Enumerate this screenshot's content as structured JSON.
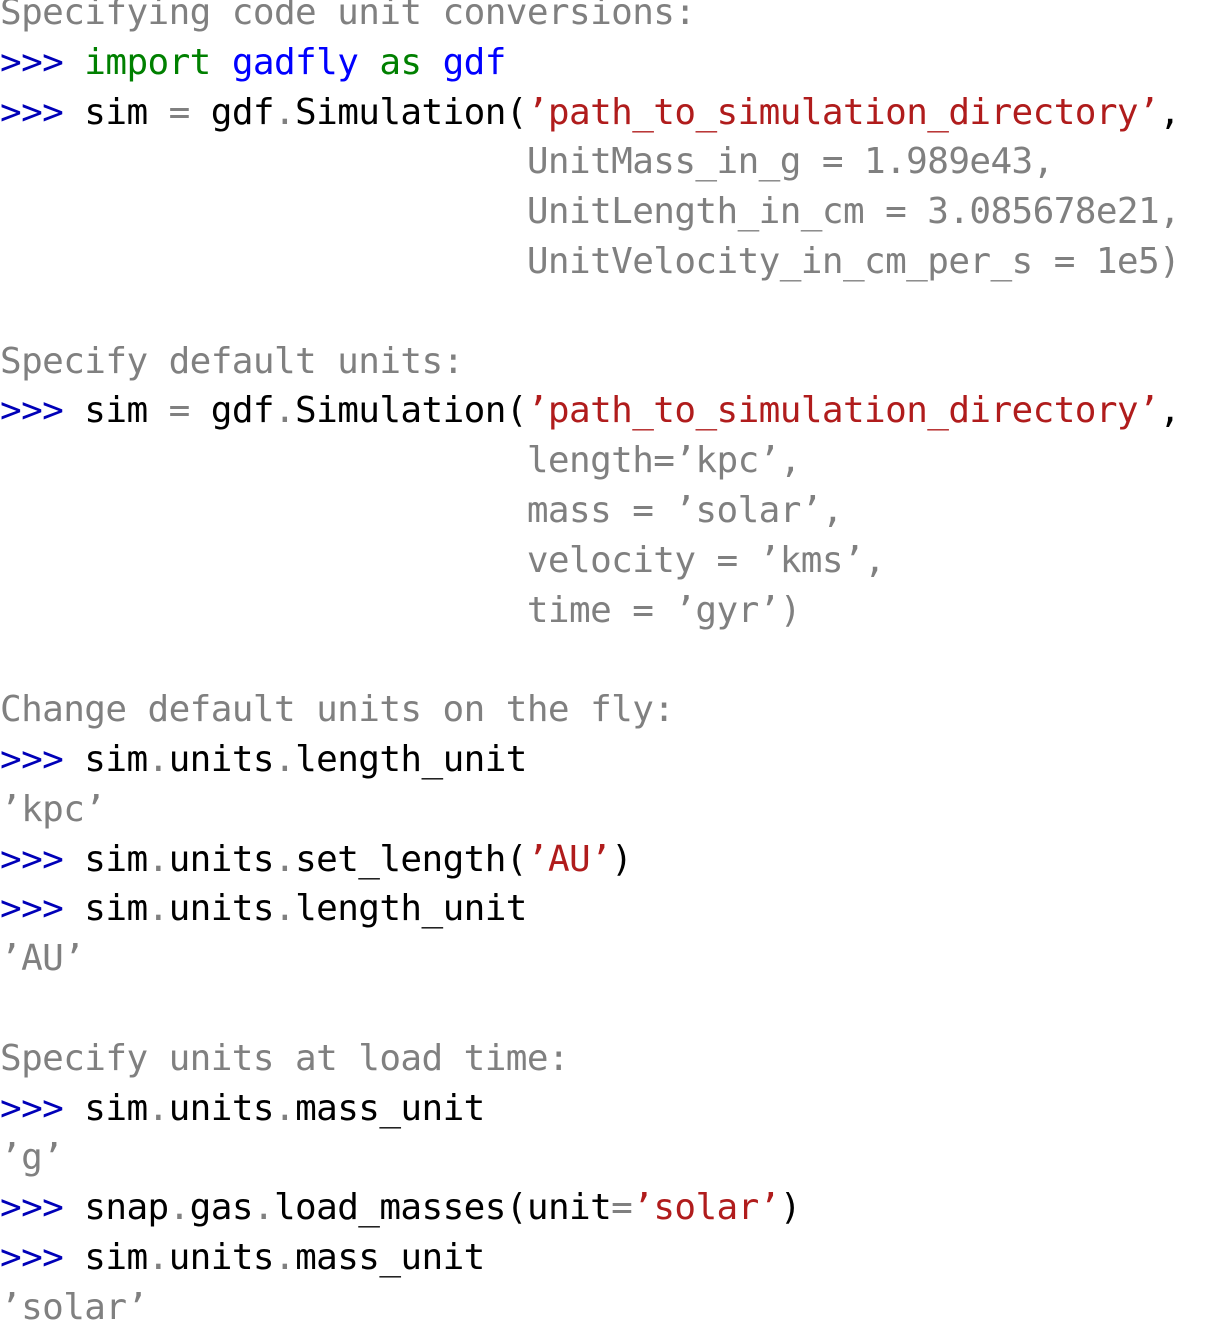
{
  "colors": {
    "prompt": "#0000b8",
    "keyword": "#008000",
    "module": "#0000ff",
    "string": "#b01c1c",
    "comment": "#808080",
    "code": "#000000",
    "operator": "#808080"
  },
  "lines": [
    [
      {
        "t": "Specifying code unit conversions:",
        "c": "comment"
      }
    ],
    [
      {
        "t": ">>> ",
        "c": "prompt"
      },
      {
        "t": "import",
        "c": "keyword"
      },
      {
        "t": " ",
        "c": "code"
      },
      {
        "t": "gadfly",
        "c": "module"
      },
      {
        "t": " ",
        "c": "code"
      },
      {
        "t": "as",
        "c": "keyword"
      },
      {
        "t": " ",
        "c": "code"
      },
      {
        "t": "gdf",
        "c": "module"
      }
    ],
    [
      {
        "t": ">>> ",
        "c": "prompt"
      },
      {
        "t": "sim ",
        "c": "code"
      },
      {
        "t": "=",
        "c": "operator"
      },
      {
        "t": " gdf",
        "c": "code"
      },
      {
        "t": ".",
        "c": "operator"
      },
      {
        "t": "Simulation(",
        "c": "code"
      },
      {
        "t": "’path_to_simulation_directory’",
        "c": "string"
      },
      {
        "t": ",",
        "c": "code"
      }
    ],
    [
      {
        "t": "                         UnitMass_in_g = 1.989e43,",
        "c": "comment"
      }
    ],
    [
      {
        "t": "                         UnitLength_in_cm = 3.085678e21,",
        "c": "comment"
      }
    ],
    [
      {
        "t": "                         UnitVelocity_in_cm_per_s = 1e5)",
        "c": "comment"
      }
    ],
    [],
    [
      {
        "t": "Specify default units:",
        "c": "comment"
      }
    ],
    [
      {
        "t": ">>> ",
        "c": "prompt"
      },
      {
        "t": "sim ",
        "c": "code"
      },
      {
        "t": "=",
        "c": "operator"
      },
      {
        "t": " gdf",
        "c": "code"
      },
      {
        "t": ".",
        "c": "operator"
      },
      {
        "t": "Simulation(",
        "c": "code"
      },
      {
        "t": "’path_to_simulation_directory’",
        "c": "string"
      },
      {
        "t": ",",
        "c": "code"
      }
    ],
    [
      {
        "t": "                         length=’kpc’,",
        "c": "comment"
      }
    ],
    [
      {
        "t": "                         mass = ’solar’,",
        "c": "comment"
      }
    ],
    [
      {
        "t": "                         velocity = ’kms’,",
        "c": "comment"
      }
    ],
    [
      {
        "t": "                         time = ’gyr’)",
        "c": "comment"
      }
    ],
    [],
    [
      {
        "t": "Change default units on the fly:",
        "c": "comment"
      }
    ],
    [
      {
        "t": ">>> ",
        "c": "prompt"
      },
      {
        "t": "sim",
        "c": "code"
      },
      {
        "t": ".",
        "c": "operator"
      },
      {
        "t": "units",
        "c": "code"
      },
      {
        "t": ".",
        "c": "operator"
      },
      {
        "t": "length_unit",
        "c": "code"
      }
    ],
    [
      {
        "t": "’kpc’",
        "c": "comment"
      }
    ],
    [
      {
        "t": ">>> ",
        "c": "prompt"
      },
      {
        "t": "sim",
        "c": "code"
      },
      {
        "t": ".",
        "c": "operator"
      },
      {
        "t": "units",
        "c": "code"
      },
      {
        "t": ".",
        "c": "operator"
      },
      {
        "t": "set_length(",
        "c": "code"
      },
      {
        "t": "’AU’",
        "c": "string"
      },
      {
        "t": ")",
        "c": "code"
      }
    ],
    [
      {
        "t": ">>> ",
        "c": "prompt"
      },
      {
        "t": "sim",
        "c": "code"
      },
      {
        "t": ".",
        "c": "operator"
      },
      {
        "t": "units",
        "c": "code"
      },
      {
        "t": ".",
        "c": "operator"
      },
      {
        "t": "length_unit",
        "c": "code"
      }
    ],
    [
      {
        "t": "’AU’",
        "c": "comment"
      }
    ],
    [],
    [
      {
        "t": "Specify units at load time:",
        "c": "comment"
      }
    ],
    [
      {
        "t": ">>> ",
        "c": "prompt"
      },
      {
        "t": "sim",
        "c": "code"
      },
      {
        "t": ".",
        "c": "operator"
      },
      {
        "t": "units",
        "c": "code"
      },
      {
        "t": ".",
        "c": "operator"
      },
      {
        "t": "mass_unit",
        "c": "code"
      }
    ],
    [
      {
        "t": "’g’",
        "c": "comment"
      }
    ],
    [
      {
        "t": ">>> ",
        "c": "prompt"
      },
      {
        "t": "snap",
        "c": "code"
      },
      {
        "t": ".",
        "c": "operator"
      },
      {
        "t": "gas",
        "c": "code"
      },
      {
        "t": ".",
        "c": "operator"
      },
      {
        "t": "load_masses(unit",
        "c": "code"
      },
      {
        "t": "=",
        "c": "operator"
      },
      {
        "t": "’solar’",
        "c": "string"
      },
      {
        "t": ")",
        "c": "code"
      }
    ],
    [
      {
        "t": ">>> ",
        "c": "prompt"
      },
      {
        "t": "sim",
        "c": "code"
      },
      {
        "t": ".",
        "c": "operator"
      },
      {
        "t": "units",
        "c": "code"
      },
      {
        "t": ".",
        "c": "operator"
      },
      {
        "t": "mass_unit",
        "c": "code"
      }
    ],
    [
      {
        "t": "’solar’",
        "c": "comment"
      }
    ]
  ]
}
